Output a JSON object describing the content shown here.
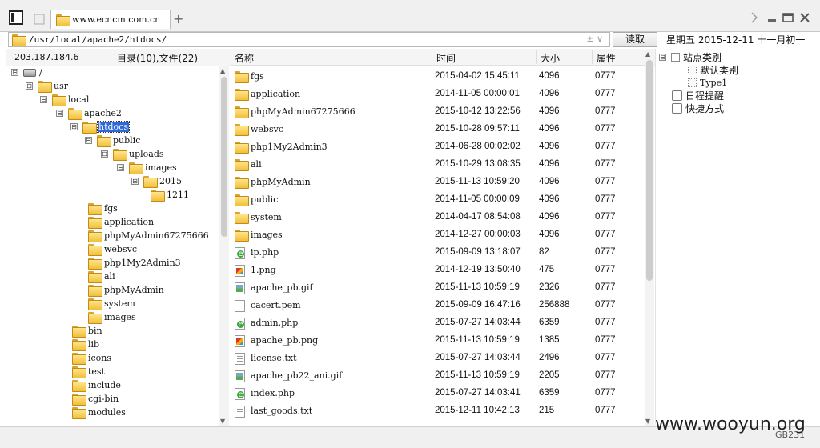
{
  "top_strip_text": "",
  "tab": {
    "title": "www.ecncm.com.cn"
  },
  "path": {
    "value": "/usr/local/apache2/htdocs/",
    "controls": "± ∨"
  },
  "read_button": "读取",
  "date": "星期五  2015-12-11  十一月初一",
  "left": {
    "ip": "203.187.184.6",
    "counts": "目录(10),文件(22)",
    "tree": [
      {
        "label": "/",
        "type": "drive",
        "expander": "⊟"
      },
      {
        "label": "usr",
        "type": "folder",
        "expander": "⊟"
      },
      {
        "label": "local",
        "type": "folder",
        "expander": "⊟"
      },
      {
        "label": "apache2",
        "type": "folder",
        "expander": "⊟"
      },
      {
        "label": "htdocs",
        "type": "folder",
        "expander": "⊟",
        "selected": true
      },
      {
        "label": "public",
        "type": "folder",
        "expander": "⊟"
      },
      {
        "label": "uploads",
        "type": "folder",
        "expander": "⊟"
      },
      {
        "label": "images",
        "type": "folder",
        "expander": "⊟"
      },
      {
        "label": "2015",
        "type": "folder",
        "expander": "⊟"
      },
      {
        "label": "1211",
        "type": "folder"
      },
      {
        "label": "fgs",
        "type": "folder"
      },
      {
        "label": "application",
        "type": "folder"
      },
      {
        "label": "phpMyAdmin67275666",
        "type": "folder"
      },
      {
        "label": "websvc",
        "type": "folder"
      },
      {
        "label": "php1My2Admin3",
        "type": "folder"
      },
      {
        "label": "ali",
        "type": "folder"
      },
      {
        "label": "phpMyAdmin",
        "type": "folder"
      },
      {
        "label": "system",
        "type": "folder"
      },
      {
        "label": "images",
        "type": "folder"
      },
      {
        "label": "bin",
        "type": "folder"
      },
      {
        "label": "lib",
        "type": "folder"
      },
      {
        "label": "icons",
        "type": "folder"
      },
      {
        "label": "test",
        "type": "folder"
      },
      {
        "label": "include",
        "type": "folder"
      },
      {
        "label": "cgi-bin",
        "type": "folder"
      },
      {
        "label": "modules",
        "type": "folder"
      }
    ]
  },
  "files": {
    "headers": {
      "name": "名称",
      "time": "时间",
      "size": "大小",
      "attr": "属性"
    },
    "rows": [
      {
        "name": "fgs",
        "time": "2015-04-02 15:45:11",
        "size": "4096",
        "attr": "0777",
        "icon": "folder"
      },
      {
        "name": "application",
        "time": "2014-11-05 00:00:01",
        "size": "4096",
        "attr": "0777",
        "icon": "folder"
      },
      {
        "name": "phpMyAdmin67275666",
        "time": "2015-10-12 13:22:56",
        "size": "4096",
        "attr": "0777",
        "icon": "folder"
      },
      {
        "name": "websvc",
        "time": "2015-10-28 09:57:11",
        "size": "4096",
        "attr": "0777",
        "icon": "folder"
      },
      {
        "name": "php1My2Admin3",
        "time": "2014-06-28 00:02:02",
        "size": "4096",
        "attr": "0777",
        "icon": "folder"
      },
      {
        "name": "ali",
        "time": "2015-10-29 13:08:35",
        "size": "4096",
        "attr": "0777",
        "icon": "folder"
      },
      {
        "name": "phpMyAdmin",
        "time": "2015-11-13 10:59:20",
        "size": "4096",
        "attr": "0777",
        "icon": "folder"
      },
      {
        "name": "public",
        "time": "2014-11-05 00:00:09",
        "size": "4096",
        "attr": "0777",
        "icon": "folder"
      },
      {
        "name": "system",
        "time": "2014-04-17 08:54:08",
        "size": "4096",
        "attr": "0777",
        "icon": "folder"
      },
      {
        "name": "images",
        "time": "2014-12-27 00:00:03",
        "size": "4096",
        "attr": "0777",
        "icon": "folder"
      },
      {
        "name": "ip.php",
        "time": "2015-09-09 13:18:07",
        "size": "82",
        "attr": "0777",
        "icon": "php"
      },
      {
        "name": "1.png",
        "time": "2014-12-19 13:50:40",
        "size": "475",
        "attr": "0777",
        "icon": "img"
      },
      {
        "name": "apache_pb.gif",
        "time": "2015-11-13 10:59:19",
        "size": "2326",
        "attr": "0777",
        "icon": "gif"
      },
      {
        "name": "cacert.pem",
        "time": "2015-09-09 16:47:16",
        "size": "256888",
        "attr": "0777",
        "icon": "file"
      },
      {
        "name": "admin.php",
        "time": "2015-07-27 14:03:44",
        "size": "6359",
        "attr": "0777",
        "icon": "php"
      },
      {
        "name": "apache_pb.png",
        "time": "2015-11-13 10:59:19",
        "size": "1385",
        "attr": "0777",
        "icon": "img"
      },
      {
        "name": "license.txt",
        "time": "2015-07-27 14:03:44",
        "size": "2496",
        "attr": "0777",
        "icon": "txt"
      },
      {
        "name": "apache_pb22_ani.gif",
        "time": "2015-11-13 10:59:19",
        "size": "2205",
        "attr": "0777",
        "icon": "gif"
      },
      {
        "name": "index.php",
        "time": "2015-07-27 14:03:41",
        "size": "6359",
        "attr": "0777",
        "icon": "php"
      },
      {
        "name": "last_goods.txt",
        "time": "2015-12-11 10:42:13",
        "size": "215",
        "attr": "0777",
        "icon": "txt"
      }
    ]
  },
  "right": {
    "items": [
      {
        "label": "站点类别",
        "expander": "⊟"
      },
      {
        "label": "默认类别"
      },
      {
        "label": "Type1"
      },
      {
        "label": "日程提醒"
      },
      {
        "label": "快捷方式"
      }
    ]
  },
  "watermark": "www.wooyun.org",
  "gb": "GB231"
}
